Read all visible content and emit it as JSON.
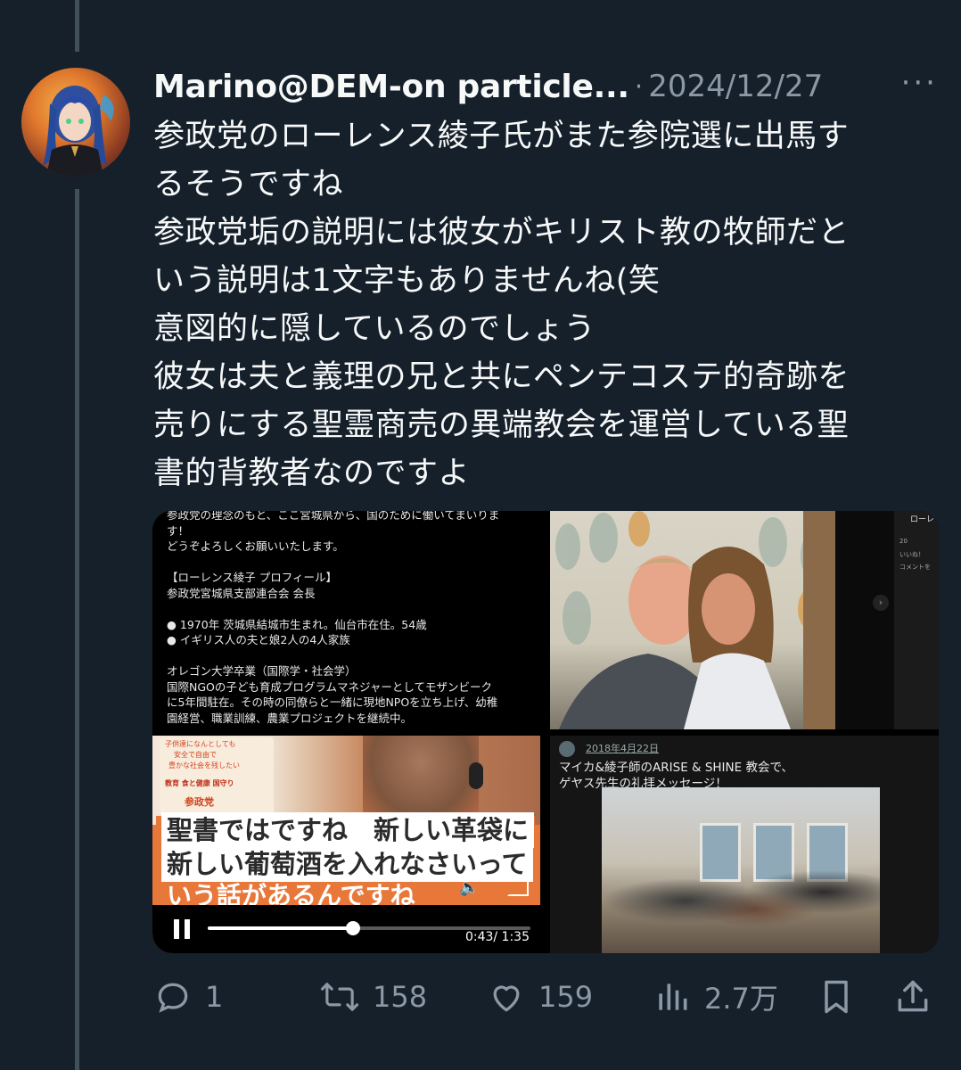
{
  "tweet": {
    "author_name": "Marino@DEM-on particle...",
    "separator": "·",
    "date": "2024/12/27",
    "more": "···",
    "lines": [
      "参政党のローレンス綾子氏がまた参院選に出馬す",
      "るそうですね",
      "参政党垢の説明には彼女がキリスト教の牧師だと",
      "いう説明は1文字もありませんね(笑",
      "意図的に隠しているのでしょう",
      "彼女は夫と義理の兄と共にペンテコステ的奇跡を",
      "売りにする聖霊商売の異端教会を運営している聖",
      "書的背教者なのですよ"
    ]
  },
  "media": {
    "doc": {
      "lines": [
        "参政党の理念のもと、ここ宮城県から、国のために働いてまいりま",
        "す！",
        "どうぞよろしくお願いいたします。",
        "",
        "【ローレンス綾子 プロフィール】",
        "参政党宮城県支部連合会 会長",
        "",
        "● 1970年 茨城県結城市生まれ。仙台市在住。54歳",
        "● イギリス人の夫と娘2人の4人家族",
        "",
        "オレゴン大学卒業（国際学・社会学）",
        "国際NGOの子ども育成プログラムマネジャーとしてモザンビーク",
        "に5年間駐在。その時の同僚らと一緒に現地NPOを立ち上げ、幼稚",
        "園経営、職業訓練、農業プロジェクトを継続中。"
      ]
    },
    "photo": {
      "fb_name": "ローレ",
      "fb_counts": "20",
      "fb_action": "いいね！",
      "fb_comment": "コメントを",
      "next_icon": "›"
    },
    "video": {
      "banner_lines": [
        "子供達になんとしても",
        "安全で自由で",
        "豊かな社会を残したい"
      ],
      "banner_tags": "教育 食と健康 国守り",
      "banner_logo": "参政党",
      "caption_line1": "聖書ではですね　新しい革袋に",
      "caption_line2": "新しい葡萄酒を入れなさいって",
      "caption_line3": "いう話があるんですね",
      "time": "0:43/ 1:35",
      "progress": 0.45
    },
    "post": {
      "date": "2018年4月22日",
      "line1": "マイカ&綾子師のARISE & SHINE 教会で、",
      "line2": "ゲヤス先生の礼拝メッセージ！"
    }
  },
  "actions": {
    "reply_count": "1",
    "retweet_count": "158",
    "like_count": "159",
    "view_count": "2.7万"
  },
  "colors": {
    "background": "#15202b",
    "text": "#f7f9f9",
    "muted": "#8b98a5"
  }
}
